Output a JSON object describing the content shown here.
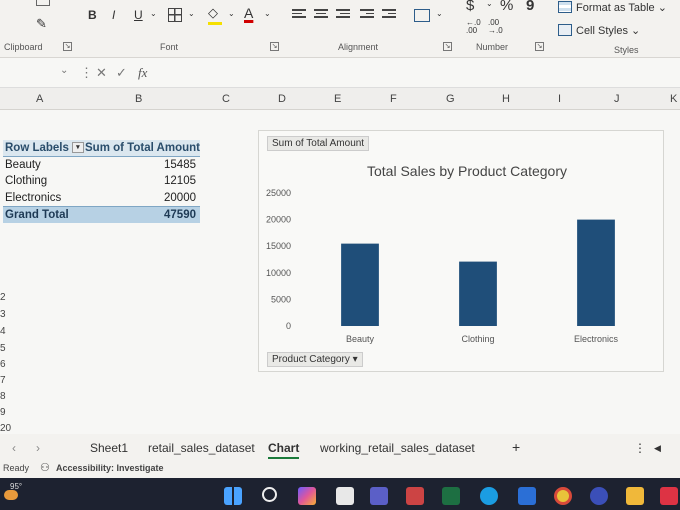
{
  "ribbon": {
    "font_buttons": {
      "bold": "B",
      "italic": "I",
      "underline": "U"
    },
    "number": {
      "currency": "$",
      "percent": "%",
      "comma": "9",
      "inc_decimal": "←.0\n.00",
      "dec_decimal": ".00\n→.0"
    },
    "styles": {
      "format_as_table": "Format as Table",
      "cell_styles": "Cell Styles"
    },
    "groups": {
      "clipboard": "Clipboard",
      "font": "Font",
      "alignment": "Alignment",
      "number": "Number",
      "styles": "Styles"
    }
  },
  "formula_bar": {
    "fx": "fx"
  },
  "columns": [
    "A",
    "B",
    "C",
    "D",
    "E",
    "F",
    "G",
    "H",
    "I",
    "J",
    "K"
  ],
  "row_numbers": [
    "2",
    "3",
    "4",
    "5",
    "6",
    "7",
    "8",
    "9",
    "20"
  ],
  "pivot": {
    "header": {
      "labels": "Row Labels",
      "sum": "Sum of Total Amount"
    },
    "rows": [
      {
        "label": "Beauty",
        "value": "15485"
      },
      {
        "label": "Clothing",
        "value": "12105"
      },
      {
        "label": "Electronics",
        "value": "20000"
      }
    ],
    "total": {
      "label": "Grand Total",
      "value": "47590"
    }
  },
  "chart": {
    "value_field": "Sum of Total Amount",
    "axis_field": "Product Category"
  },
  "chart_data": {
    "type": "bar",
    "title": "Total Sales by Product Category",
    "categories": [
      "Beauty",
      "Clothing",
      "Electronics"
    ],
    "values": [
      15485,
      12105,
      20000
    ],
    "ylim": [
      0,
      25000
    ],
    "yticks": [
      "0",
      "5000",
      "10000",
      "15000",
      "20000",
      "25000"
    ],
    "xlabel": "",
    "ylabel": "",
    "bar_color": "#1f4e79",
    "grid": false,
    "legend": "none"
  },
  "sheet_tabs": {
    "items": [
      "Sheet1",
      "retail_sales_dataset",
      "Chart",
      "working_retail_sales_dataset"
    ],
    "active": "Chart",
    "add": "+"
  },
  "status": {
    "ready": "Ready",
    "accessibility": "Accessibility: Investigate"
  },
  "taskbar": {
    "weather": "95°"
  }
}
